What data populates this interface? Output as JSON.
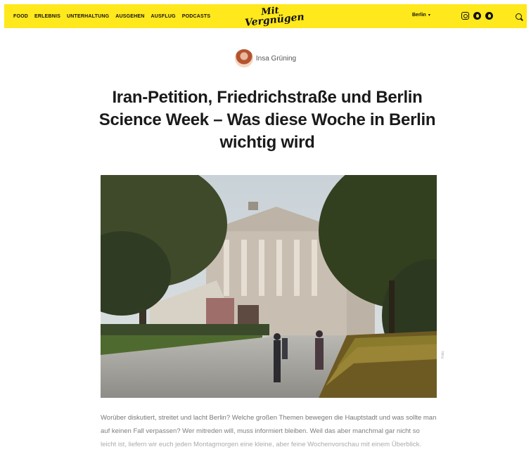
{
  "nav": {
    "links": [
      "Food",
      "Erlebnis",
      "Unterhaltung",
      "Ausgehen",
      "Ausflug",
      "Podcasts"
    ],
    "logo_line1": "Mit",
    "logo_line2": "Vergnügen",
    "city": "Berlin",
    "icons": [
      "instagram-icon",
      "facebook-icon",
      "spotify-icon",
      "search-icon"
    ]
  },
  "author": {
    "name": "Insa Grüning"
  },
  "article": {
    "headline": "Iran-Petition, Friedrichstraße und Berlin Science Week – Was diese Woche in Berlin wichtig wird",
    "image_credit": "Foto: ",
    "body": "Worüber diskutiert, streitet und lacht Berlin? Welche großen Themen bewegen die Hauptstadt und was sollte man auf keinen Fall verpassen? Wer mitreden will, muss informiert bleiben. Weil das aber manchmal gar nicht so leicht ist, liefern wir euch jeden Montagmorgen eine kleine, aber feine Wochenvorschau mit einem Überblick."
  },
  "colors": {
    "brand_yellow": "#ffe81c"
  }
}
